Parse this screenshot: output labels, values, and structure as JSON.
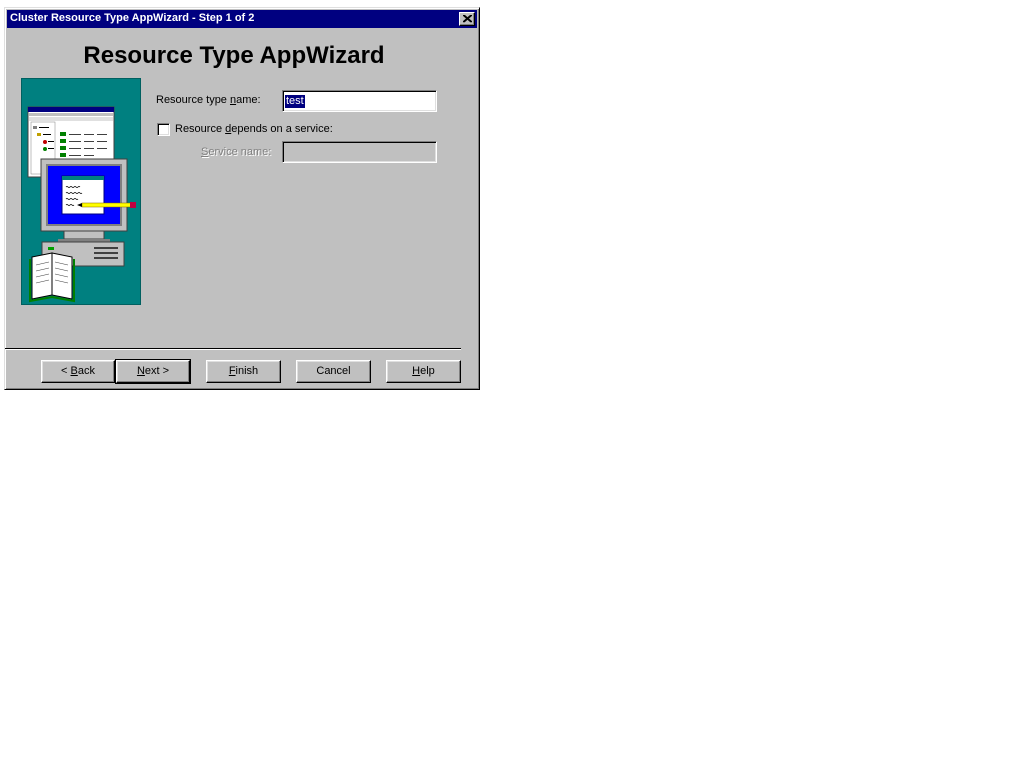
{
  "window": {
    "title": "Cluster Resource Type AppWizard - Step 1 of 2"
  },
  "wizard": {
    "heading": "Resource Type AppWizard"
  },
  "form": {
    "resource_type_name": {
      "label_pre": "Resource type ",
      "label_accel": "n",
      "label_post": "ame:",
      "value": "test"
    },
    "depends_on_service": {
      "label_pre": "Resource ",
      "label_accel": "d",
      "label_post": "epends on a service:",
      "checked": false
    },
    "service_name": {
      "label_accel": "S",
      "label_post": "ervice name:",
      "value": "",
      "enabled": false
    }
  },
  "buttons": {
    "back": {
      "pre": "< ",
      "accel": "B",
      "post": "ack"
    },
    "next": {
      "pre": "",
      "accel": "N",
      "post": "ext >"
    },
    "finish": {
      "pre": "",
      "accel": "F",
      "post": "inish"
    },
    "cancel": {
      "pre": "Cancel",
      "accel": "",
      "post": ""
    },
    "help": {
      "pre": "",
      "accel": "H",
      "post": "elp"
    }
  },
  "icons": {
    "close": "close-icon",
    "illustration": "computer-illustration"
  },
  "colors": {
    "titlebar": "#000080",
    "dialog_face": "#c0c0c0",
    "illustration_bg": "#008080",
    "selection": "#000080"
  }
}
